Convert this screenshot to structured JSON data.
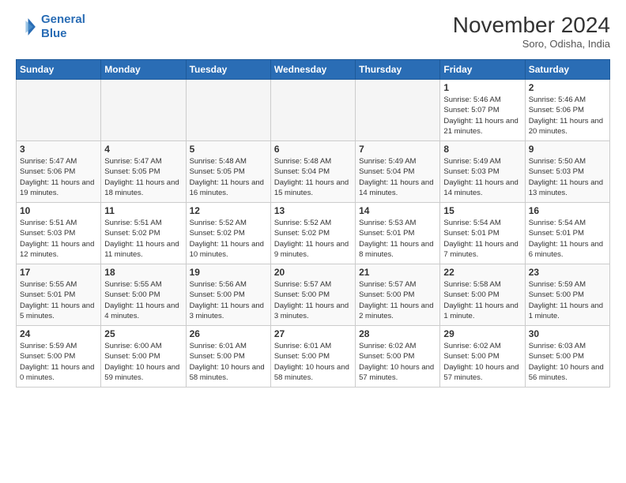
{
  "logo": {
    "line1": "General",
    "line2": "Blue"
  },
  "title": "November 2024",
  "location": "Soro, Odisha, India",
  "weekdays": [
    "Sunday",
    "Monday",
    "Tuesday",
    "Wednesday",
    "Thursday",
    "Friday",
    "Saturday"
  ],
  "weeks": [
    [
      {
        "day": "",
        "empty": true
      },
      {
        "day": "",
        "empty": true
      },
      {
        "day": "",
        "empty": true
      },
      {
        "day": "",
        "empty": true
      },
      {
        "day": "",
        "empty": true
      },
      {
        "day": "1",
        "sunrise": "5:46 AM",
        "sunset": "5:07 PM",
        "daylight": "11 hours and 21 minutes."
      },
      {
        "day": "2",
        "sunrise": "5:46 AM",
        "sunset": "5:06 PM",
        "daylight": "11 hours and 20 minutes."
      }
    ],
    [
      {
        "day": "3",
        "sunrise": "5:47 AM",
        "sunset": "5:06 PM",
        "daylight": "11 hours and 19 minutes."
      },
      {
        "day": "4",
        "sunrise": "5:47 AM",
        "sunset": "5:05 PM",
        "daylight": "11 hours and 18 minutes."
      },
      {
        "day": "5",
        "sunrise": "5:48 AM",
        "sunset": "5:05 PM",
        "daylight": "11 hours and 16 minutes."
      },
      {
        "day": "6",
        "sunrise": "5:48 AM",
        "sunset": "5:04 PM",
        "daylight": "11 hours and 15 minutes."
      },
      {
        "day": "7",
        "sunrise": "5:49 AM",
        "sunset": "5:04 PM",
        "daylight": "11 hours and 14 minutes."
      },
      {
        "day": "8",
        "sunrise": "5:49 AM",
        "sunset": "5:03 PM",
        "daylight": "11 hours and 14 minutes."
      },
      {
        "day": "9",
        "sunrise": "5:50 AM",
        "sunset": "5:03 PM",
        "daylight": "11 hours and 13 minutes."
      }
    ],
    [
      {
        "day": "10",
        "sunrise": "5:51 AM",
        "sunset": "5:03 PM",
        "daylight": "11 hours and 12 minutes."
      },
      {
        "day": "11",
        "sunrise": "5:51 AM",
        "sunset": "5:02 PM",
        "daylight": "11 hours and 11 minutes."
      },
      {
        "day": "12",
        "sunrise": "5:52 AM",
        "sunset": "5:02 PM",
        "daylight": "11 hours and 10 minutes."
      },
      {
        "day": "13",
        "sunrise": "5:52 AM",
        "sunset": "5:02 PM",
        "daylight": "11 hours and 9 minutes."
      },
      {
        "day": "14",
        "sunrise": "5:53 AM",
        "sunset": "5:01 PM",
        "daylight": "11 hours and 8 minutes."
      },
      {
        "day": "15",
        "sunrise": "5:54 AM",
        "sunset": "5:01 PM",
        "daylight": "11 hours and 7 minutes."
      },
      {
        "day": "16",
        "sunrise": "5:54 AM",
        "sunset": "5:01 PM",
        "daylight": "11 hours and 6 minutes."
      }
    ],
    [
      {
        "day": "17",
        "sunrise": "5:55 AM",
        "sunset": "5:01 PM",
        "daylight": "11 hours and 5 minutes."
      },
      {
        "day": "18",
        "sunrise": "5:55 AM",
        "sunset": "5:00 PM",
        "daylight": "11 hours and 4 minutes."
      },
      {
        "day": "19",
        "sunrise": "5:56 AM",
        "sunset": "5:00 PM",
        "daylight": "11 hours and 3 minutes."
      },
      {
        "day": "20",
        "sunrise": "5:57 AM",
        "sunset": "5:00 PM",
        "daylight": "11 hours and 3 minutes."
      },
      {
        "day": "21",
        "sunrise": "5:57 AM",
        "sunset": "5:00 PM",
        "daylight": "11 hours and 2 minutes."
      },
      {
        "day": "22",
        "sunrise": "5:58 AM",
        "sunset": "5:00 PM",
        "daylight": "11 hours and 1 minute."
      },
      {
        "day": "23",
        "sunrise": "5:59 AM",
        "sunset": "5:00 PM",
        "daylight": "11 hours and 1 minute."
      }
    ],
    [
      {
        "day": "24",
        "sunrise": "5:59 AM",
        "sunset": "5:00 PM",
        "daylight": "11 hours and 0 minutes."
      },
      {
        "day": "25",
        "sunrise": "6:00 AM",
        "sunset": "5:00 PM",
        "daylight": "10 hours and 59 minutes."
      },
      {
        "day": "26",
        "sunrise": "6:01 AM",
        "sunset": "5:00 PM",
        "daylight": "10 hours and 58 minutes."
      },
      {
        "day": "27",
        "sunrise": "6:01 AM",
        "sunset": "5:00 PM",
        "daylight": "10 hours and 58 minutes."
      },
      {
        "day": "28",
        "sunrise": "6:02 AM",
        "sunset": "5:00 PM",
        "daylight": "10 hours and 57 minutes."
      },
      {
        "day": "29",
        "sunrise": "6:02 AM",
        "sunset": "5:00 PM",
        "daylight": "10 hours and 57 minutes."
      },
      {
        "day": "30",
        "sunrise": "6:03 AM",
        "sunset": "5:00 PM",
        "daylight": "10 hours and 56 minutes."
      }
    ]
  ]
}
